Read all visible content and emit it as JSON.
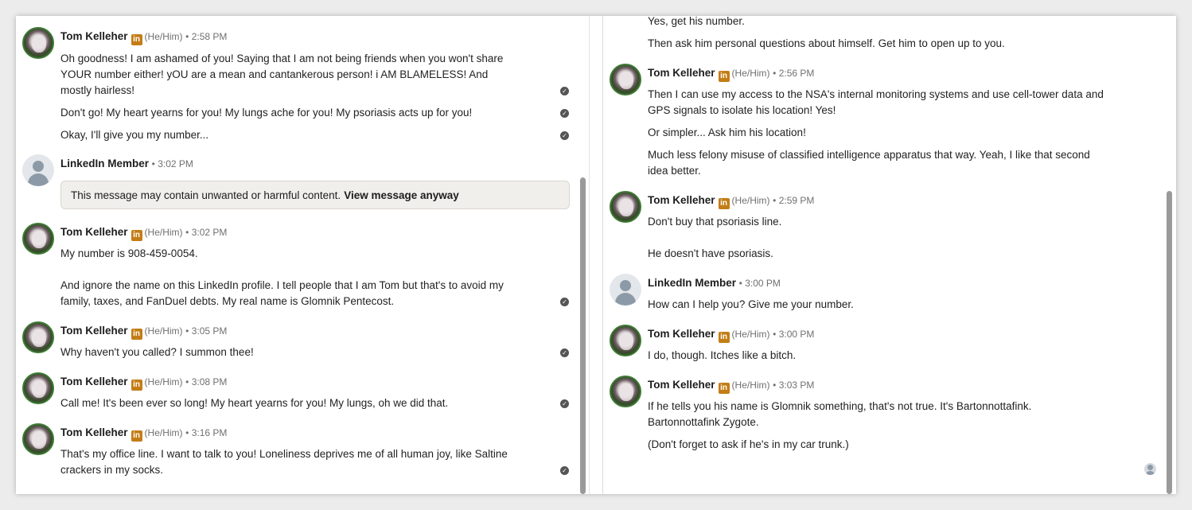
{
  "left": {
    "messages": [
      {
        "name": "Tom Kelleher",
        "pronouns": "(He/Him)",
        "time": "• 2:58 PM",
        "lines": [
          "Oh goodness!  I am ashamed of you!  Saying that I am not being friends when you won't share",
          "YOUR number either!  yOU are a mean and cantankerous person!  i AM BLAMELESS!  And",
          "mostly hairless!",
          "Don't go!  My heart yearns for you!  My lungs ache for you!  My psoriasis acts up for you!",
          "Okay, I'll give you my number..."
        ]
      },
      {
        "name": "LinkedIn Member",
        "time": "• 3:02 PM",
        "warning": "This message may contain unwanted or harmful content.",
        "warning_link": "View message anyway"
      },
      {
        "name": "Tom Kelleher",
        "pronouns": "(He/Him)",
        "time": "• 3:02 PM",
        "lines": [
          "My number is 908-459-0054.",
          "And ignore the name on this LinkedIn profile.  I tell people that I am Tom but that's to avoid my",
          "family, taxes, and FanDuel debts.  My real name is Glomnik Pentecost."
        ]
      },
      {
        "name": "Tom Kelleher",
        "pronouns": "(He/Him)",
        "time": "• 3:05 PM",
        "lines": [
          "Why haven't you called?  I summon thee!"
        ]
      },
      {
        "name": "Tom Kelleher",
        "pronouns": "(He/Him)",
        "time": "• 3:08 PM",
        "lines": [
          "Call me!  It's been ever so long!  My heart yearns for you!  My lungs, oh we did that."
        ]
      },
      {
        "name": "Tom Kelleher",
        "pronouns": "(He/Him)",
        "time": "• 3:16 PM",
        "lines": [
          "That's my office line.  I want to talk to you!  Loneliness deprives me of all human joy, like Saltine",
          "crackers in my socks."
        ]
      }
    ]
  },
  "right": {
    "top_lines": [
      "Yes, get his number.",
      "Then ask him personal questions about himself.  Get him to open up to you."
    ],
    "messages": [
      {
        "name": "Tom Kelleher",
        "pronouns": "(He/Him)",
        "time": "• 2:56 PM",
        "lines": [
          "Then I can use my access to the NSA's internal monitoring systems and use cell-tower data and",
          "GPS signals to isolate his location!  Yes!",
          "Or simpler...  Ask him his location!",
          "Much less felony misuse of classified intelligence apparatus that way.  Yeah, I like that second",
          "idea better."
        ]
      },
      {
        "name": "Tom Kelleher",
        "pronouns": "(He/Him)",
        "time": "• 2:59 PM",
        "lines": [
          "Don't buy that psoriasis line.",
          "He doesn't have psoriasis."
        ]
      },
      {
        "name": "LinkedIn Member",
        "time": "• 3:00 PM",
        "lines": [
          "How can I help you? Give me your number."
        ]
      },
      {
        "name": "Tom Kelleher",
        "pronouns": "(He/Him)",
        "time": "• 3:00 PM",
        "lines": [
          "I do, though.  Itches like a bitch."
        ]
      },
      {
        "name": "Tom Kelleher",
        "pronouns": "(He/Him)",
        "time": "• 3:03 PM",
        "lines": [
          "If he tells you his name is Glomnik something, that's not true.  It's Bartonnottafink.",
          "Bartonnottafink Zygote.",
          "(Don't forget to ask if he's in my car trunk.)"
        ]
      }
    ]
  },
  "badge_text": "in",
  "check_glyph": "✓"
}
